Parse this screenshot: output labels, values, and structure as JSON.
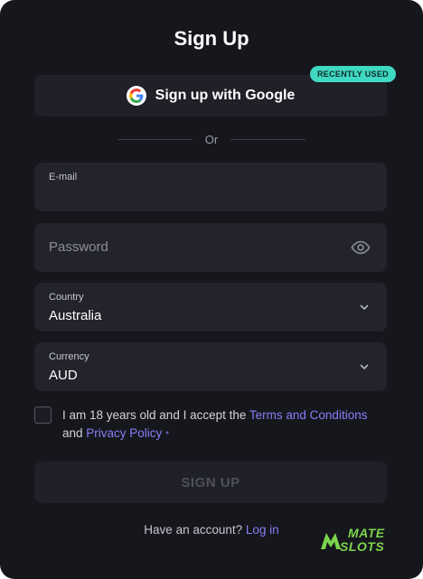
{
  "title": "Sign Up",
  "google": {
    "label": "Sign up with Google",
    "badge": "RECENTLY USED"
  },
  "divider": {
    "text": "Or"
  },
  "email": {
    "label": "E-mail",
    "value": ""
  },
  "password": {
    "placeholder": "Password",
    "icon": "eye-icon"
  },
  "country": {
    "label": "Country",
    "value": "Australia",
    "icon": "chevron-down-icon"
  },
  "currency": {
    "label": "Currency",
    "value": "AUD",
    "icon": "chevron-down-icon"
  },
  "consent": {
    "text_before": "I am 18 years old and I accept the ",
    "terms_link": "Terms and Conditions",
    "text_and": "and ",
    "privacy_link": "Privacy Policy",
    "required_mark": "*",
    "checked": false
  },
  "signup_button": {
    "label": "SIGN UP"
  },
  "footer": {
    "prompt": "Have an account?",
    "login_link": "Log in"
  },
  "logo": {
    "line1": "MATE",
    "line2": "SLOTS"
  },
  "colors": {
    "background": "#16171d",
    "field": "#22232b",
    "accent_link": "#8b7cf6",
    "badge": "#3fd8c2",
    "logo": "#7cd44c"
  }
}
